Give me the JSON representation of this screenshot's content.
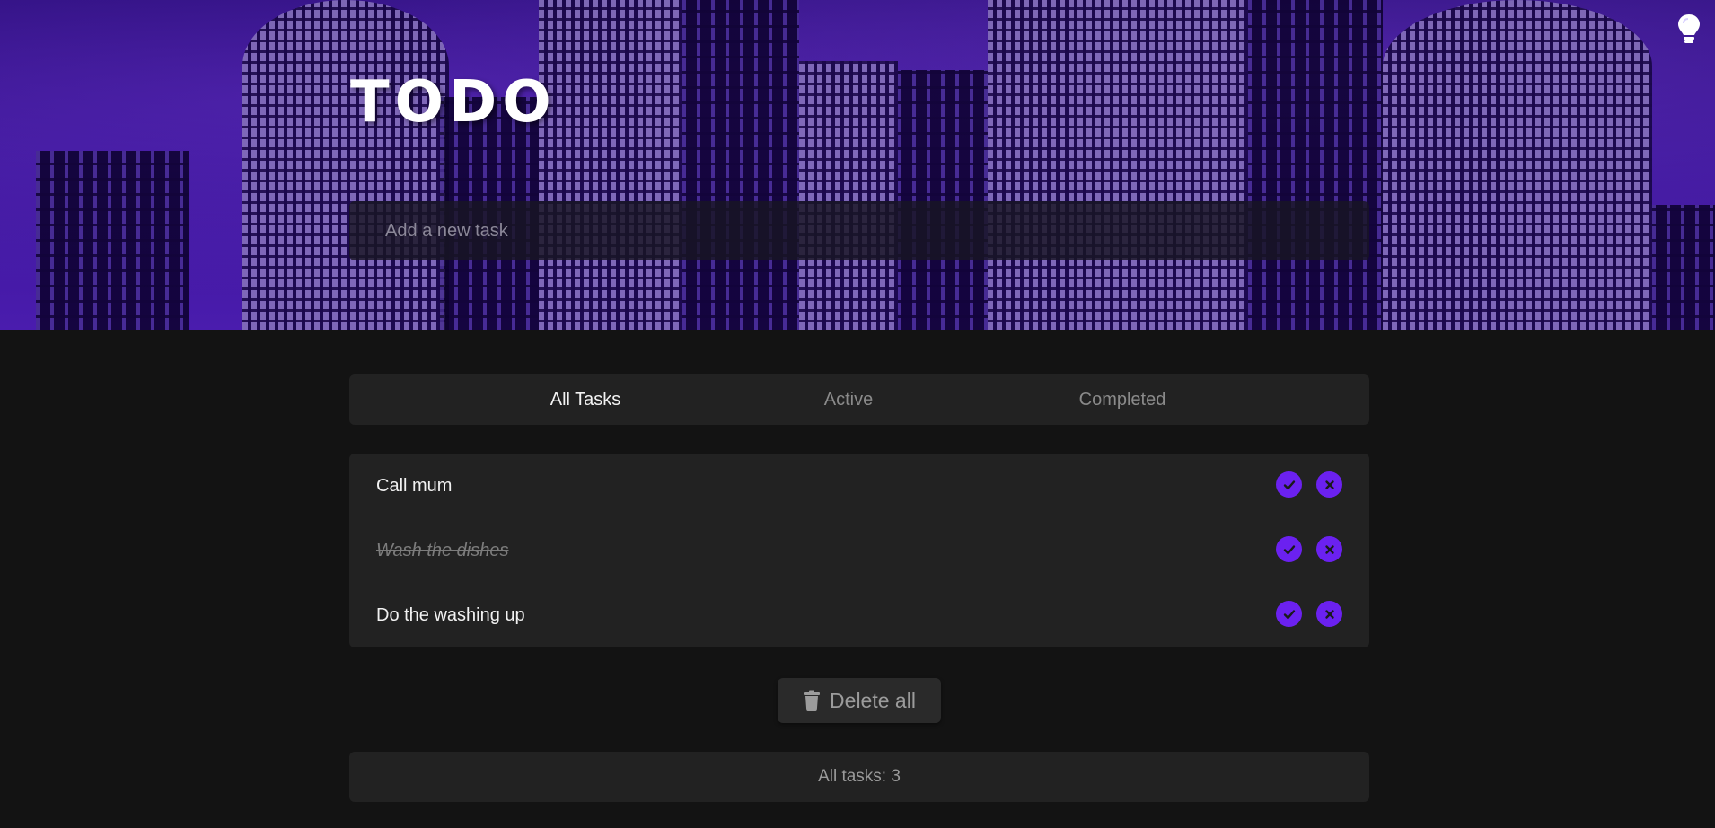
{
  "header": {
    "title": "TODO",
    "theme_toggle_icon": "lightbulb-icon",
    "new_task_placeholder": "Add a new task"
  },
  "filters": {
    "all_label": "All Tasks",
    "active_label": "Active",
    "completed_label": "Completed",
    "selected": "All Tasks"
  },
  "tasks": [
    {
      "text": "Call mum",
      "completed": false
    },
    {
      "text": "Wash the dishes",
      "completed": true
    },
    {
      "text": "Do the washing up",
      "completed": false
    }
  ],
  "actions": {
    "delete_all_label": "Delete all",
    "delete_all_icon": "trash-icon",
    "complete_icon": "check-icon",
    "remove_icon": "close-icon"
  },
  "footer": {
    "count_label": "All tasks: 3"
  },
  "colors": {
    "accent": "#6b21f0",
    "background": "#131313",
    "panel": "#222222",
    "hero": "#3a1596"
  }
}
